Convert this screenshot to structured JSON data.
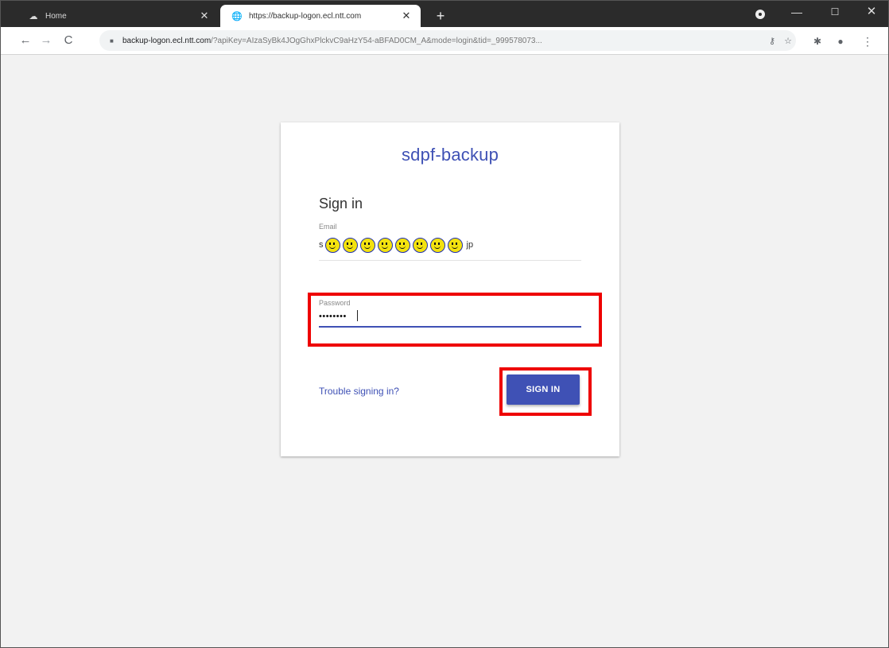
{
  "browser": {
    "tabs": [
      {
        "title": "Home",
        "icon": "cloud-icon",
        "active": false
      },
      {
        "title": "https://backup-logon.ecl.ntt.com",
        "icon": "globe-icon",
        "active": true
      }
    ],
    "new_tab_label": "+",
    "address_bar": {
      "host": "backup-logon.ecl.ntt.com",
      "rest": "/?apiKey=AIzaSyBk4JOgGhxPlckvC9aHzY54-aBFAD0CM_A&mode=login&tid=_999578073..."
    }
  },
  "page": {
    "app_title": "sdpf-backup",
    "signin_title": "Sign in",
    "email": {
      "label": "Email",
      "value_prefix": "s",
      "value_suffix": "jp",
      "masked_char_count": 8
    },
    "password": {
      "label": "Password",
      "value": "••••••••"
    },
    "trouble_link": "Trouble signing in?",
    "signin_button": "SIGN IN"
  },
  "colors": {
    "accent": "#3f51b5",
    "highlight": "#ee0000",
    "tabstrip": "#2b2b2b",
    "page_background": "#f2f2f2"
  }
}
